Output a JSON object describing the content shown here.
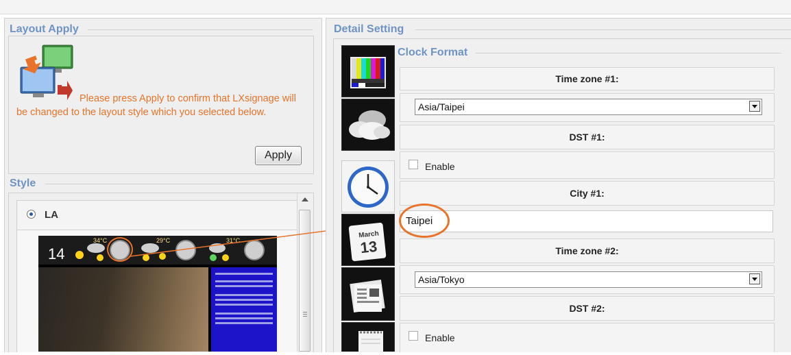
{
  "layout_apply": {
    "legend": "Layout Apply",
    "message": "Please press Apply to confirm that LXsignage will be changed to the layout style which you selected below.",
    "apply_label": "Apply"
  },
  "style": {
    "legend": "Style",
    "option_label": "LA",
    "preview_date": "14",
    "preview_temps": [
      "34°C",
      "29°C",
      "31°C"
    ]
  },
  "detail": {
    "legend": "Detail Setting",
    "clock_format_legend": "Clock Format",
    "tz1_label": "Time zone #1:",
    "tz1_value": "Asia/Taipei",
    "dst1_label": "DST #1:",
    "enable1_label": "Enable",
    "city1_label": "City #1:",
    "city1_value": "Taipei",
    "tz2_label": "Time zone #2:",
    "tz2_value": "Asia/Tokyo",
    "dst2_label": "DST #2:",
    "enable2_label": "Enable",
    "calendar_month": "March",
    "calendar_day": "13"
  },
  "colors": {
    "legend": "#6f93c4",
    "message": "#e8732a",
    "highlight": "#e8732a"
  },
  "icons": [
    "monitors-swap-icon",
    "color-bars-icon",
    "cloud-icon",
    "clock-icon",
    "calendar-icon",
    "newspaper-icon",
    "notepad-icon"
  ]
}
